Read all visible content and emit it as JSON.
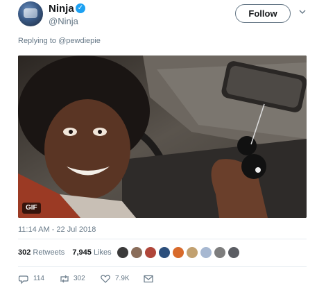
{
  "author": {
    "name": "Ninja",
    "handle": "@Ninja",
    "verified": true
  },
  "follow_label": "Follow",
  "reply": {
    "prefix": "Replying to",
    "mention": "@pewdiepie"
  },
  "media": {
    "badge": "GIF"
  },
  "timestamp": "11:14 AM - 22 Jul 2018",
  "stats": {
    "retweets_count": "302",
    "retweets_label": "Retweets",
    "likes_count": "7,945",
    "likes_label": "Likes"
  },
  "actions": {
    "replies": "114",
    "retweets": "302",
    "likes": "7.9K"
  },
  "colors": {
    "accent": "#1da1f2",
    "muted": "#657786",
    "text": "#14171a"
  },
  "icons": [
    "verified-badge-icon",
    "chevron-down-icon",
    "reply-icon",
    "retweet-icon",
    "like-icon",
    "message-icon"
  ]
}
